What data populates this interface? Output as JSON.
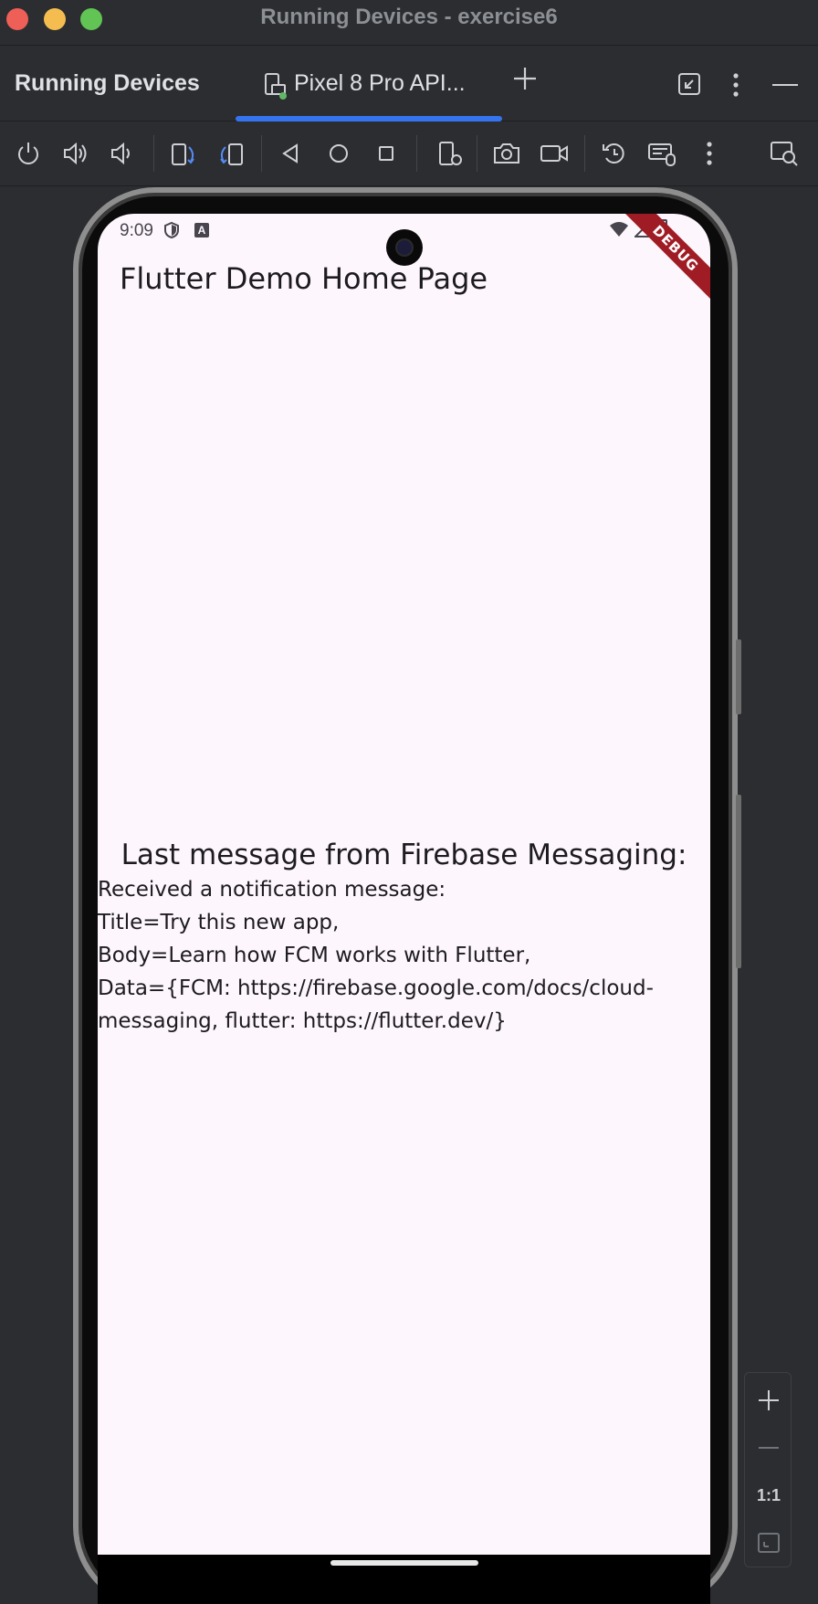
{
  "window": {
    "title": "Running Devices - exercise6"
  },
  "panel": {
    "title": "Running Devices",
    "device_tab_label": "Pixel 8 Pro API..."
  },
  "toolbar": {
    "buttons": [
      "power-icon",
      "volume-up-icon",
      "volume-down-icon",
      "rotate-left-icon",
      "rotate-right-icon",
      "back-icon",
      "home-icon",
      "overview-icon",
      "device-settings-icon",
      "camera-icon",
      "record-icon",
      "reset-icon",
      "keyboard-mouse-icon",
      "more-icon",
      "inspect-icon"
    ]
  },
  "status_bar": {
    "time": "9:09",
    "debug_banner": "DEBUG"
  },
  "app": {
    "title": "Flutter Demo Home Page",
    "message_heading": "Last message from Firebase Messaging:",
    "message_lines": [
      "Received a notification message:",
      "Title=Try this new app,",
      "Body=Learn how FCM works with Flutter,",
      "Data={FCM: https://firebase.google.com/docs/cloud-",
      "messaging, flutter: https://flutter.dev/}"
    ]
  },
  "zoom": {
    "one_to_one": "1:1"
  },
  "colors": {
    "accent": "#3574f0",
    "ide_background": "#2b2d30",
    "app_background": "#fdf7fd",
    "debug_banner": "#a01c24"
  }
}
